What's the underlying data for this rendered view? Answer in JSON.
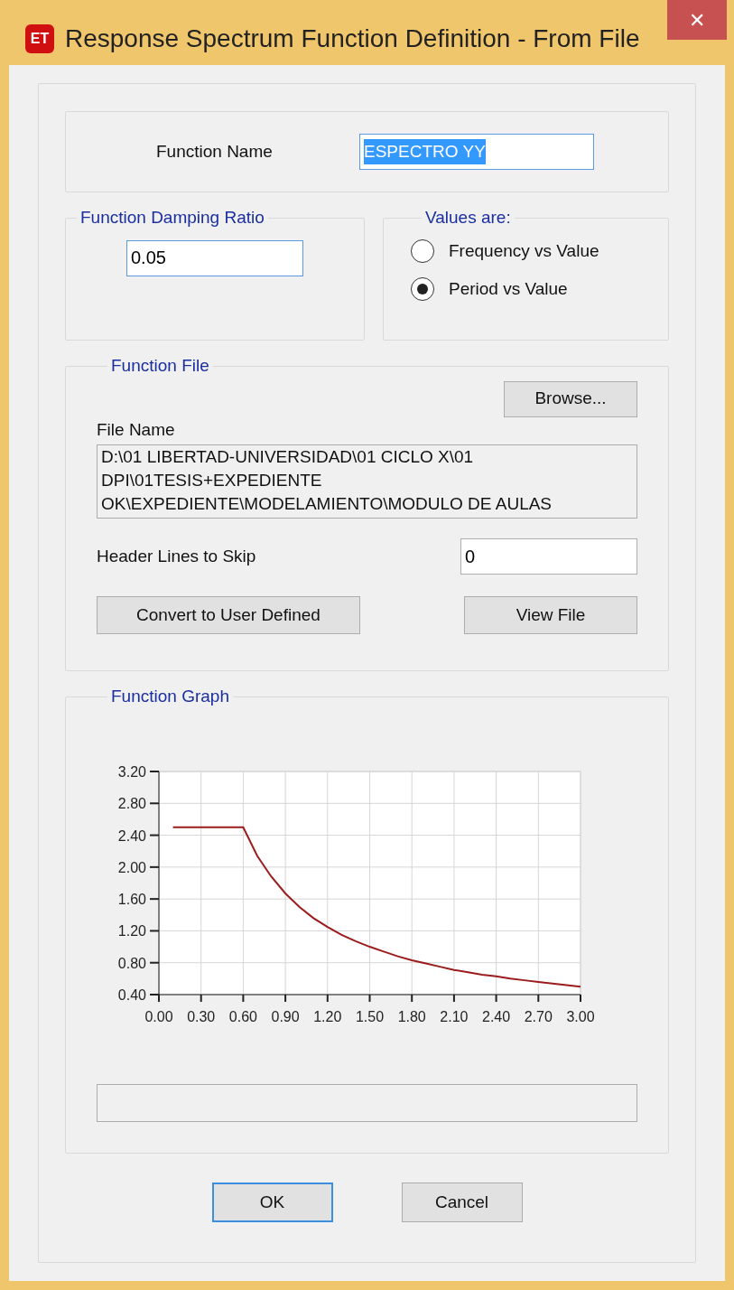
{
  "window": {
    "title": "Response Spectrum Function Definition - From File",
    "close": "✕",
    "app_icon": "ET"
  },
  "function_name": {
    "label": "Function Name",
    "value": "ESPECTRO YY",
    "highlighted": true
  },
  "damping": {
    "title": "Function Damping Ratio",
    "value": "0.05"
  },
  "values_are": {
    "title": "Values are:",
    "options": [
      {
        "label": "Frequency vs Value",
        "selected": false
      },
      {
        "label": "Period vs Value",
        "selected": true
      }
    ]
  },
  "function_file": {
    "title": "Function File",
    "browse": "Browse...",
    "file_name_label": "File Name",
    "file_name": "D:\\01 LIBERTAD-UNIVERSIDAD\\01 CICLO X\\01 DPI\\01TESIS+EXPEDIENTE OK\\EXPEDIENTE\\MODELAMIENTO\\MODULO DE AULAS",
    "header_label": "Header Lines to Skip",
    "header_value": "0",
    "convert": "Convert to User Defined",
    "view": "View File"
  },
  "function_graph": {
    "title": "Function Graph",
    "chart_data": {
      "type": "line",
      "x": [
        0.1,
        0.2,
        0.3,
        0.4,
        0.5,
        0.6,
        0.7,
        0.8,
        0.9,
        1.0,
        1.1,
        1.2,
        1.3,
        1.4,
        1.5,
        1.6,
        1.7,
        1.8,
        1.9,
        2.0,
        2.1,
        2.2,
        2.3,
        2.4,
        2.5,
        2.6,
        2.7,
        2.8,
        2.9,
        3.0
      ],
      "grid": true,
      "series": [
        {
          "color": "#9b1c1c",
          "values": [
            2.5,
            2.5,
            2.5,
            2.5,
            2.5,
            2.5,
            2.14,
            1.88,
            1.67,
            1.5,
            1.36,
            1.25,
            1.15,
            1.07,
            1.0,
            0.94,
            0.88,
            0.83,
            0.79,
            0.75,
            0.71,
            0.68,
            0.65,
            0.63,
            0.6,
            0.58,
            0.56,
            0.54,
            0.52,
            0.5
          ]
        }
      ],
      "xlim": [
        0,
        3
      ],
      "ylim": [
        0.4,
        3.2
      ],
      "xticks": [
        {
          "value": 0,
          "label": "0.00"
        },
        {
          "value": 0.3,
          "label": "0.30"
        },
        {
          "value": 0.6,
          "label": "0.60"
        },
        {
          "value": 0.9,
          "label": "0.90"
        },
        {
          "value": 1.2,
          "label": "1.20"
        },
        {
          "value": 1.5,
          "label": "1.50"
        },
        {
          "value": 1.8,
          "label": "1.80"
        },
        {
          "value": 2.1,
          "label": "2.10"
        },
        {
          "value": 2.4,
          "label": "2.40"
        },
        {
          "value": 2.7,
          "label": "2.70"
        },
        {
          "value": 3.0,
          "label": "3.00"
        }
      ],
      "yticks": [
        {
          "value": 0.4,
          "label": "0.40"
        },
        {
          "value": 0.8,
          "label": "0.80"
        },
        {
          "value": 1.2,
          "label": "1.20"
        },
        {
          "value": 1.6,
          "label": "1.60"
        },
        {
          "value": 2.0,
          "label": "2.00"
        },
        {
          "value": 2.4,
          "label": "2.40"
        },
        {
          "value": 2.8,
          "label": "2.80"
        },
        {
          "value": 3.2,
          "label": "3.20"
        }
      ]
    }
  },
  "buttons": [
    {
      "label": "OK",
      "selected": true
    },
    {
      "label": "Cancel",
      "selected": false
    }
  ]
}
